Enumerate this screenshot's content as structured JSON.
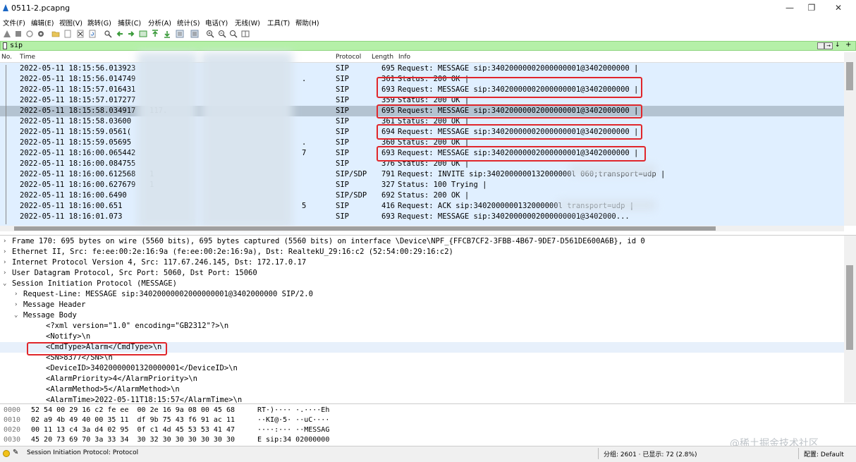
{
  "window": {
    "title": "0511-2.pcapng",
    "controls": {
      "minimize": "—",
      "maximize": "❐",
      "close": "✕"
    }
  },
  "menu": [
    "文件(F)",
    "编辑(E)",
    "视图(V)",
    "跳转(G)",
    "捕获(C)",
    "分析(A)",
    "统计(S)",
    "电话(Y)",
    "无线(W)",
    "工具(T)",
    "帮助(H)"
  ],
  "toolbar": {
    "icons": [
      "shark-start-icon",
      "stop-icon",
      "restart-icon",
      "options-icon",
      "open-file-icon",
      "save-icon",
      "close-file-icon",
      "reload-icon",
      "find-icon",
      "back-icon",
      "forward-icon",
      "goto-icon",
      "first-icon",
      "last-icon",
      "autoscroll-icon",
      "colorize-icon",
      "zoom-in-icon",
      "zoom-out-icon",
      "zoom-normal-icon",
      "resize-columns-icon"
    ]
  },
  "filter": {
    "value": "sip",
    "expression_label": "↓",
    "plus_label": "+"
  },
  "packet_list": {
    "columns": [
      "No.",
      "Time",
      "Protocol",
      "Length",
      "Info"
    ],
    "rows": [
      {
        "time": "2022-05-11 18:15:56.013923",
        "src": "",
        "dst": "",
        "proto": "SIP",
        "length": "695",
        "info": "Request: MESSAGE sip:34020000002000000001@3402000000 |",
        "selected": false,
        "boxed": false
      },
      {
        "time": "2022-05-11 18:15:56.014749",
        "src": "",
        "dst": ".",
        "proto": "SIP",
        "length": "361",
        "info": "Status: 200 OK |",
        "selected": false,
        "boxed": false
      },
      {
        "time": "2022-05-11 18:15:57.016431",
        "src": "",
        "dst": "",
        "proto": "SIP",
        "length": "693",
        "info": "Request: MESSAGE sip:34020000002000000001@3402000000 |",
        "selected": false,
        "boxed": true
      },
      {
        "time": "2022-05-11 18:15:57.017277",
        "src": "",
        "dst": "",
        "proto": "SIP",
        "length": "359",
        "info": "Status: 200 OK |",
        "selected": false,
        "boxed": false
      },
      {
        "time": "2022-05-11 18:15:58.034917",
        "src": "117.",
        "dst": "",
        "proto": "SIP",
        "length": "695",
        "info": "Request: MESSAGE sip:34020000002000000001@3402000000 |",
        "selected": true,
        "boxed": true
      },
      {
        "time": "2022-05-11 18:15:58.03600",
        "src": "",
        "dst": "",
        "proto": "SIP",
        "length": "361",
        "info": "Status: 200 OK |",
        "selected": false,
        "boxed": false
      },
      {
        "time": "2022-05-11 18:15:59.0561(",
        "src": "",
        "dst": "",
        "proto": "SIP",
        "length": "694",
        "info": "Request: MESSAGE sip:34020000002000000001@3402000000 |",
        "selected": false,
        "boxed": true
      },
      {
        "time": "2022-05-11 18:15:59.05695",
        "src": "",
        "dst": ".",
        "proto": "SIP",
        "length": "360",
        "info": "Status: 200 OK |",
        "selected": false,
        "boxed": false
      },
      {
        "time": "2022-05-11 18:16:00.065442",
        "src": "",
        "dst": "7",
        "proto": "SIP",
        "length": "693",
        "info": "Request: MESSAGE sip:34020000002000000001@3402000000 |",
        "selected": false,
        "boxed": true
      },
      {
        "time": "2022-05-11 18:16:00.084755",
        "src": "",
        "dst": "",
        "proto": "SIP",
        "length": "376",
        "info": "Status: 200 OK |",
        "selected": false,
        "boxed": false
      },
      {
        "time": "2022-05-11 18:16:00.612568",
        "src": "1",
        "dst": "",
        "proto": "SIP/SDP",
        "length": "791",
        "info": "Request: INVITE sip:3402000000132000000l                    060;transport=udp |",
        "selected": false,
        "boxed": false
      },
      {
        "time": "2022-05-11 18:16:00.627679",
        "src": "1",
        "dst": "",
        "proto": "SIP",
        "length": "327",
        "info": "Status: 100 Trying |",
        "selected": false,
        "boxed": false
      },
      {
        "time": "2022-05-11 18:16:00.6490",
        "src": "",
        "dst": "",
        "proto": "SIP/SDP",
        "length": "692",
        "info": "Status: 200 OK |",
        "selected": false,
        "boxed": false
      },
      {
        "time": "2022-05-11 18:16:00.651",
        "src": "",
        "dst": "5",
        "proto": "SIP",
        "length": "416",
        "info": "Request: ACK sip:3402000000132000000l                        transport=udp |",
        "selected": false,
        "boxed": false
      },
      {
        "time": "2022-05-11 18:16:01.073",
        "src": "",
        "dst": "",
        "proto": "SIP",
        "length": "693",
        "info": "Request: MESSAGE sip:34020000002000000001@3402000...",
        "selected": false,
        "boxed": false
      }
    ]
  },
  "details": {
    "rows": [
      {
        "arrow": "›",
        "indent": 0,
        "text": "Frame 170: 695 bytes on wire (5560 bits), 695 bytes captured (5560 bits) on interface \\Device\\NPF_{FFCB7CF2-3FBB-4B67-9DE7-D561DE600A6B}, id 0"
      },
      {
        "arrow": "›",
        "indent": 0,
        "text": "Ethernet II, Src: fe:ee:00:2e:16:9a (fe:ee:00:2e:16:9a), Dst: RealtekU_29:16:c2 (52:54:00:29:16:c2)"
      },
      {
        "arrow": "›",
        "indent": 0,
        "text": "Internet Protocol Version 4, Src: 117.67.246.145, Dst: 172.17.0.17"
      },
      {
        "arrow": "›",
        "indent": 0,
        "text": "User Datagram Protocol, Src Port: 5060, Dst Port: 15060"
      },
      {
        "arrow": "⌄",
        "indent": 0,
        "text": "Session Initiation Protocol (MESSAGE)"
      },
      {
        "arrow": "›",
        "indent": 1,
        "text": "Request-Line: MESSAGE sip:34020000002000000001@3402000000 SIP/2.0"
      },
      {
        "arrow": "›",
        "indent": 1,
        "text": "Message Header"
      },
      {
        "arrow": "⌄",
        "indent": 1,
        "text": "Message Body"
      },
      {
        "arrow": "",
        "indent": 3,
        "text": "<?xml version=\"1.0\" encoding=\"GB2312\"?>\\n"
      },
      {
        "arrow": "",
        "indent": 3,
        "text": "<Notify>\\n"
      },
      {
        "arrow": "",
        "indent": 3,
        "text": "<CmdType>Alarm</CmdType>\\n"
      },
      {
        "arrow": "",
        "indent": 3,
        "text": "<SN>8377</SN>\\n"
      },
      {
        "arrow": "",
        "indent": 3,
        "text": "<DeviceID>34020000001320000001</DeviceID>\\n"
      },
      {
        "arrow": "",
        "indent": 3,
        "text": "<AlarmPriority>4</AlarmPriority>\\n"
      },
      {
        "arrow": "",
        "indent": 3,
        "text": "<AlarmMethod>5</AlarmMethod>\\n"
      },
      {
        "arrow": "",
        "indent": 3,
        "text": "<AlarmTime>2022-05-11T18:15:57</AlarmTime>\\n"
      }
    ]
  },
  "bytes": {
    "rows": [
      {
        "offset": "0000",
        "hex": "52 54 00 29 16 c2 fe ee  00 2e 16 9a 08 00 45 68",
        "ascii": "RT·)···· ·.····Eh"
      },
      {
        "offset": "0010",
        "hex": "02 a9 4b 49 40 00 35 11  df 9b 75 43 f6 91 ac 11",
        "ascii": "··KI@·5· ··uC····"
      },
      {
        "offset": "0020",
        "hex": "00 11 13 c4 3a d4 02 95  0f c1 4d 45 53 53 41 47",
        "ascii": "····:··· ··MESSAG"
      },
      {
        "offset": "0030",
        "hex": "45 20 73 69 70 3a 33 34  30 32 30 30 30 30 30 30",
        "ascii": "E sip:34 02000000"
      }
    ]
  },
  "status": {
    "edit_icon": "✎",
    "protocol_text": "Session Initiation Protocol: Protocol",
    "packets_text": "分组: 2601 · 已显示: 72 (2.8%)",
    "profile_text": "配置: Default"
  },
  "watermark": "@稀土掘金技术社区",
  "colors": {
    "list_bg": "#e0efff",
    "selected_row": "#b4c3d1",
    "filter_bg": "#b5f0a8",
    "highlight_box": "#e0262b"
  }
}
